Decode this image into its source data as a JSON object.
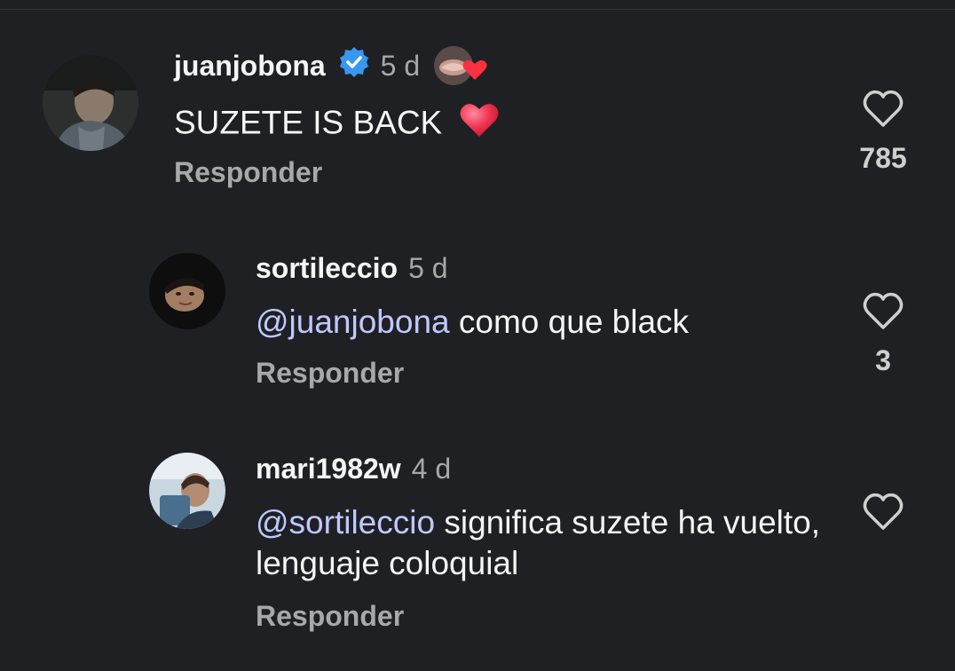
{
  "comments": [
    {
      "username": "juanjobona",
      "verified": true,
      "time": "5 d",
      "mention": "",
      "text": "SUZETE IS BACK",
      "emoji": "❤️",
      "reply_label": "Responder",
      "likes": "785"
    },
    {
      "username": "sortileccio",
      "verified": false,
      "time": "5 d",
      "mention": "@juanjobona",
      "text": " como que black",
      "reply_label": "Responder",
      "likes": "3"
    },
    {
      "username": "mari1982w",
      "verified": false,
      "time": "4 d",
      "mention": "@sortileccio",
      "text": " significa suzete ha vuelto, lenguaje coloquial",
      "reply_label": "Responder",
      "likes": ""
    }
  ],
  "colors": {
    "background": "#1f2024",
    "verified_badge": "#3897f0",
    "heart_red": "#ff3040",
    "mention": "#c0c8ff",
    "secondary_text": "#a8a8a8"
  },
  "icons": [
    "verified-badge-icon",
    "heart-outline-icon",
    "heart-filled-icon",
    "at-sign-icon"
  ]
}
